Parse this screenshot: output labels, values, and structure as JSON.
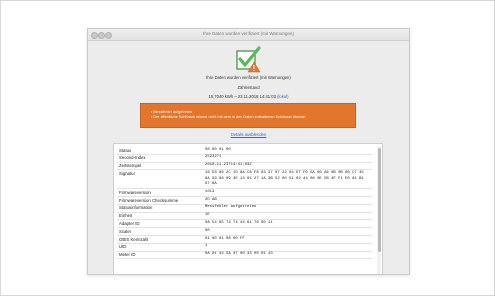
{
  "window": {
    "title": "Ihre Daten wurden verifiziert (mit Warnungen)"
  },
  "summary": {
    "message": "Ihre Daten wurden verifiziert (mit Warnungen)",
    "meter_label": "Zählerstand",
    "reading": "15,7040 kWh – 23.11.2018 14:41:03",
    "reading_unit_link": "(lokal)"
  },
  "warnings": [
    "Messfehler aufgetreten",
    "Der öffentliche Schlüssel stimmt nicht mit dem in den Daten enthaltenen Schlüssel überein"
  ],
  "details_link": "Details ausblenden",
  "colors": {
    "warning_bg": "#e2762c",
    "check_green": "#5cb85c",
    "link": "#2b6fc7"
  },
  "details_table": [
    {
      "key": "Status",
      "value": "08 00 01 00"
    },
    {
      "key": "Second-Index",
      "value": "2523271"
    },
    {
      "key": "Zeitstempel",
      "value": "2018-11-23T14:41:03Z"
    },
    {
      "key": "Signatur",
      "value": "16 D3 86 2C 1D 8A C8 F8 83 37 07 22 04 D7 F0 5A 60 A6 8B 0B 66 C7 45 8A 93 88 09 3E 13 01 27 1A 3B 52 00 51 02 44 08 0E 5B 4F F1 E0 81 B1 97 8A"
    },
    {
      "key": "Firmwareversion",
      "value": "v013"
    },
    {
      "key": "Firmwareversion Checksumme",
      "value": "2D AB"
    },
    {
      "key": "Statusinformation",
      "value": "Messfehler aufgetreten"
    },
    {
      "key": "Einheit",
      "value": "1E"
    },
    {
      "key": "Adapter ID",
      "value": "0A 54 65 73 74 44 61 76 00 11"
    },
    {
      "key": "Scaler",
      "value": "00"
    },
    {
      "key": "OBIS Kennzahl",
      "value": "01 00 01 08 00 FF"
    },
    {
      "key": "UID",
      "value": "1"
    },
    {
      "key": "Meter ID",
      "value": "0A 01 44 5A 47 00 33 00 01 43"
    }
  ]
}
